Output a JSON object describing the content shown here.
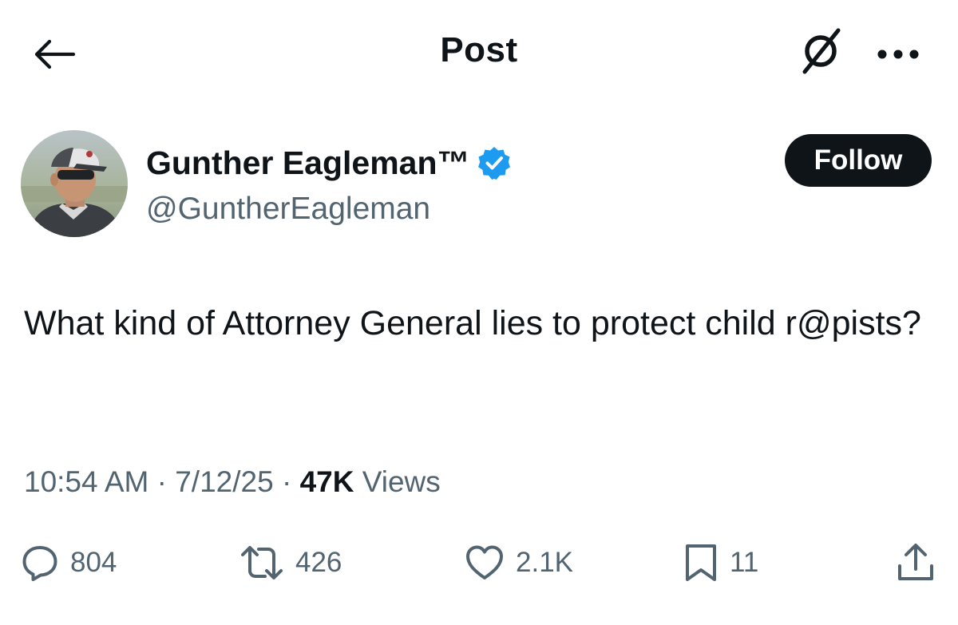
{
  "header": {
    "title": "Post",
    "back_icon": "arrow-left-icon",
    "grok_icon": "grok-icon",
    "more_icon": "more-horizontal-icon"
  },
  "author": {
    "display_name": "Gunther Eagleman™",
    "handle": "@GuntherEagleman",
    "verified": true,
    "verified_color": "#1d9bf0",
    "follow_label": "Follow"
  },
  "post": {
    "text": "What kind of Attorney General lies to protect child r@pists?",
    "time": "10:54 AM",
    "date": "7/12/25",
    "separator": "·",
    "views_count": "47K",
    "views_label": "Views"
  },
  "actions": {
    "replies": "804",
    "reposts": "426",
    "likes": "2.1K",
    "bookmarks": "11"
  },
  "colors": {
    "text_primary": "#0f1419",
    "text_secondary": "#536471",
    "follow_bg": "#0f1419",
    "background": "#ffffff"
  }
}
